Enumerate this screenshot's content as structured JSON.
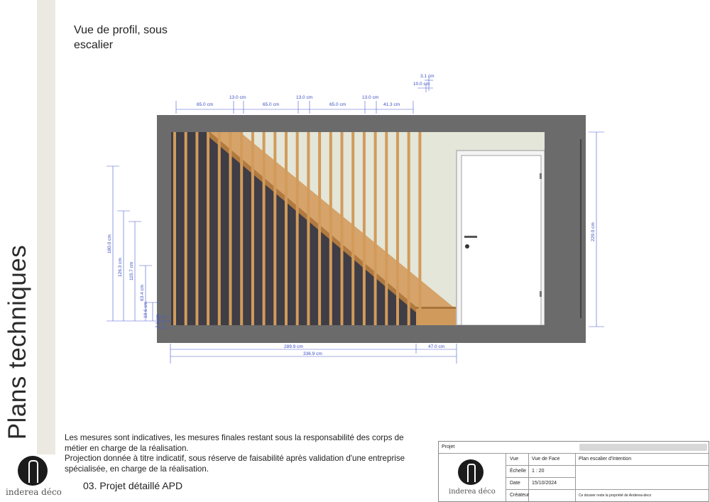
{
  "sidebar": {
    "title": "Plans techniques"
  },
  "view": {
    "title": "Vue de profil, sous escalier"
  },
  "dimensions": {
    "top_65a": "65.0 cm",
    "top_13a": "13.0 cm",
    "top_65b": "65.0 cm",
    "top_13b": "13.0 cm",
    "top_65c": "65.0 cm",
    "top_13c": "13.0 cm",
    "top_41": "41.3 cm",
    "top_10": "10.0 cm",
    "top_3": "3.1 cm",
    "left_180": "180.0 cm",
    "left_126": "126.3 cm",
    "left_115": "115.7 cm",
    "left_63": "63.4 cm",
    "left_19": "19.6 cm",
    "left_7": "7.6 cm",
    "right_229": "229.0 cm",
    "bottom_289": "289.9 cm",
    "bottom_47": "47.0 cm",
    "bottom_336": "336.9 cm"
  },
  "notes": {
    "line1": "Les mesures sont indicatives, les mesures finales restant sous la responsabilité des corps de métier en charge de la réalisation.",
    "line2": "Projection donnée à titre indicatif, sous réserve de faisabilité après validation d'une entreprise spécialisée, en charge de la réalisation."
  },
  "phase": {
    "label": "03. Projet détaillé APD"
  },
  "brand": {
    "name": "inderea déco"
  },
  "title_block": {
    "projet_label": "Projet",
    "vue_label": "Vue",
    "vue_value": "Vue de Face",
    "echelle_label": "Échelle",
    "echelle_value": "1 : 20",
    "date_label": "Date",
    "date_value": "15/10/2024",
    "createur_label": "Créateur",
    "plan_name": "Plan escalier d'Intention",
    "property_note": "Ce dossier reste la propriété de Anderea-deco"
  },
  "colors": {
    "wall": "#6b6b6b",
    "stair_wood": "#cf9a5c",
    "under_stair": "#3f3d45",
    "wall_light": "#e3e6d8",
    "door": "#ffffff",
    "dim": "#3b4dbf"
  }
}
